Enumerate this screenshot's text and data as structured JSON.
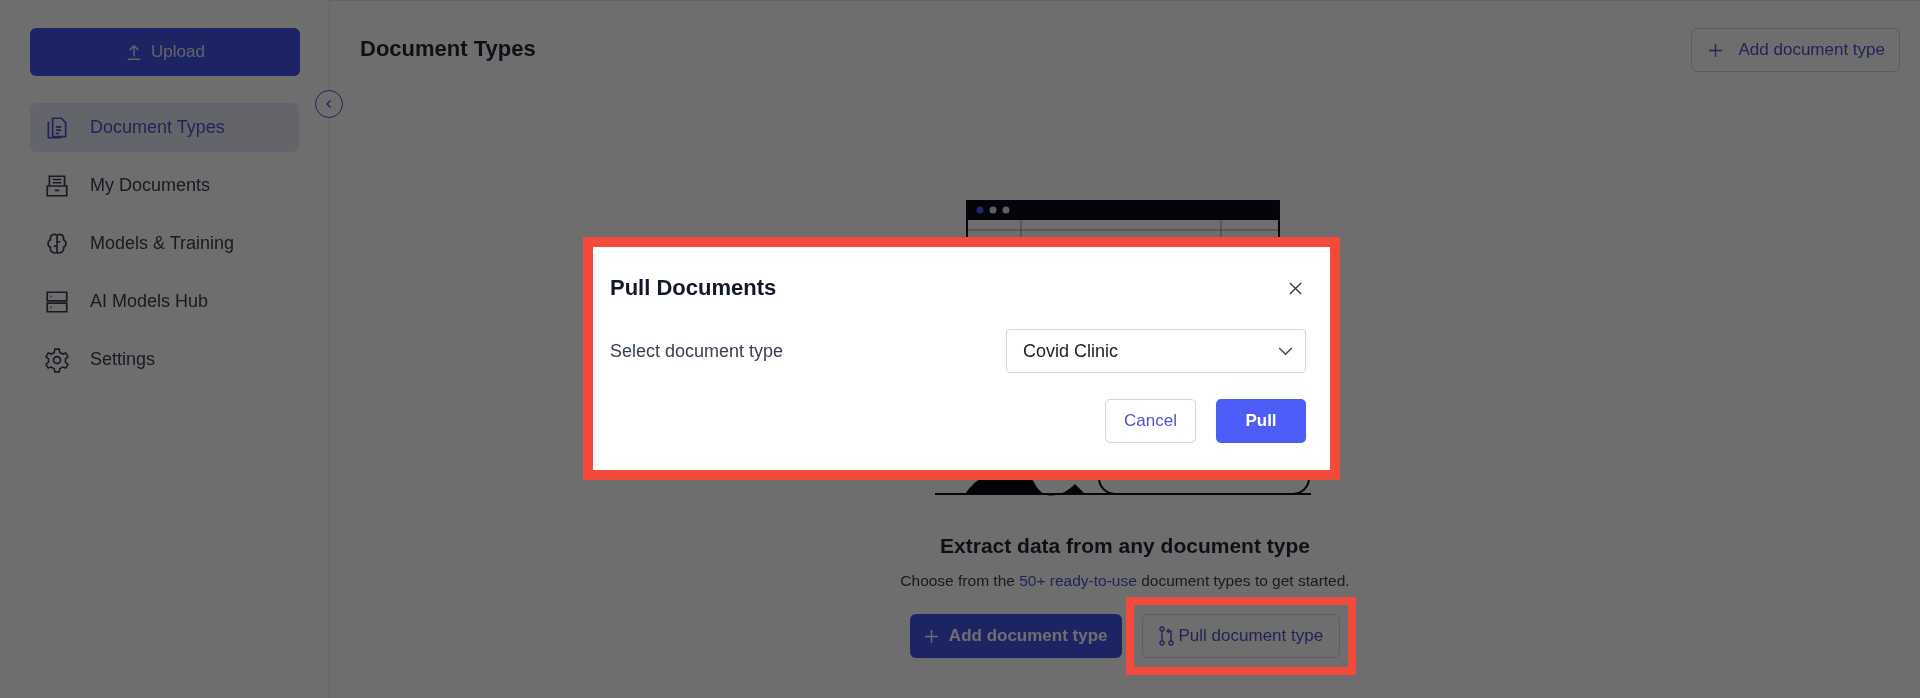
{
  "sidebar": {
    "upload_button": "Upload",
    "items": [
      {
        "label": "Document Types",
        "selected": true
      },
      {
        "label": "My Documents",
        "selected": false
      },
      {
        "label": "Models & Training",
        "selected": false
      },
      {
        "label": "AI Models Hub",
        "selected": false
      },
      {
        "label": "Settings",
        "selected": false
      }
    ]
  },
  "main": {
    "title": "Document Types",
    "add_button": "Add document type",
    "empty_state": {
      "heading": "Extract data from any document type",
      "text_before": "Choose from the",
      "link": "50+ ready-to-use",
      "text_after": "document types to get started.",
      "add_button": "Add document type",
      "pull_button": "Pull document type"
    }
  },
  "modal": {
    "title": "Pull Documents",
    "field_label": "Select document type",
    "select_value": "Covid Clinic",
    "buttons": [
      {
        "label": "Cancel",
        "kind": "secondary"
      },
      {
        "label": "Pull",
        "kind": "primary"
      }
    ]
  }
}
